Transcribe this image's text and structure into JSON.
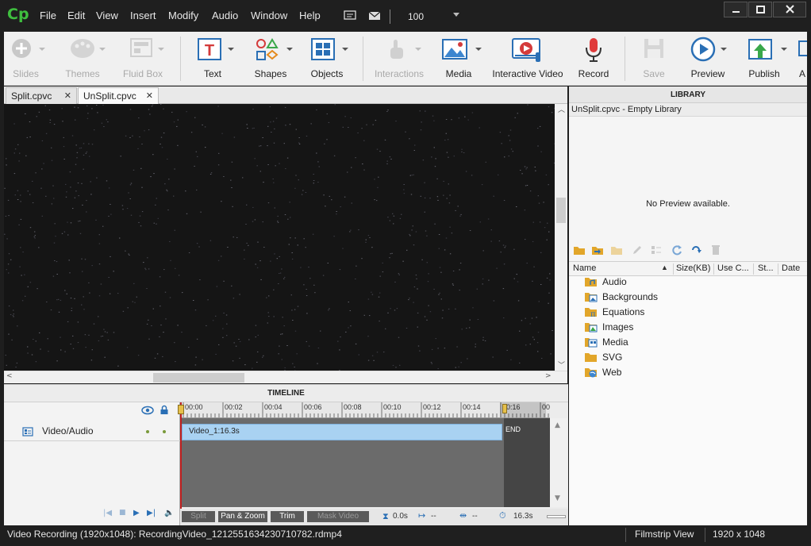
{
  "app": {
    "logo": "Cp",
    "menu": [
      "File",
      "Edit",
      "View",
      "Insert",
      "Modify",
      "Audio",
      "Window",
      "Help"
    ],
    "zoom": "100",
    "titlebar_icons": [
      "captions-icon",
      "mail-icon"
    ],
    "window_controls": [
      "minimize",
      "maximize",
      "close"
    ]
  },
  "toolbar": {
    "items": [
      {
        "label": "Slides",
        "icon": "add-slide-icon",
        "enabled": false
      },
      {
        "label": "Themes",
        "icon": "palette-icon",
        "enabled": false
      },
      {
        "label": "Fluid Box",
        "icon": "fluid-box-icon",
        "enabled": false
      },
      {
        "label": "Text",
        "icon": "text-icon",
        "enabled": true
      },
      {
        "label": "Shapes",
        "icon": "shapes-icon",
        "enabled": true
      },
      {
        "label": "Objects",
        "icon": "objects-icon",
        "enabled": true
      },
      {
        "label": "Interactions",
        "icon": "hand-pointer-icon",
        "enabled": false
      },
      {
        "label": "Media",
        "icon": "image-icon",
        "enabled": true
      },
      {
        "label": "Interactive Video",
        "icon": "interactive-video-icon",
        "enabled": true
      },
      {
        "label": "Record",
        "icon": "microphone-icon",
        "enabled": true
      },
      {
        "label": "Save",
        "icon": "save-icon",
        "enabled": false
      },
      {
        "label": "Preview",
        "icon": "play-circle-icon",
        "enabled": true
      },
      {
        "label": "Publish",
        "icon": "publish-icon",
        "enabled": true
      },
      {
        "label": "A",
        "icon": "",
        "enabled": true
      }
    ]
  },
  "tabs": [
    {
      "label": "Split.cpvc",
      "active": false
    },
    {
      "label": "UnSplit.cpvc",
      "active": true
    }
  ],
  "timeline": {
    "header": "TIMELINE",
    "track_label": "Video/Audio",
    "ruler": [
      "00:00",
      "00:02",
      "00:04",
      "00:06",
      "00:08",
      "00:10",
      "00:12",
      "00:14",
      "00:16",
      "00:"
    ],
    "clip_label": "Video_1:16.3s",
    "end_label": "END",
    "buttons": [
      {
        "label": "Split",
        "enabled": false
      },
      {
        "label": "Pan & Zoom",
        "enabled": true
      },
      {
        "label": "Trim",
        "enabled": true
      },
      {
        "label": "Mask Video",
        "enabled": false
      }
    ],
    "current_time": "0.0s",
    "in_point": "--",
    "out_point": "--",
    "duration": "16.3s"
  },
  "library": {
    "header": "LIBRARY",
    "subtitle": "UnSplit.cpvc - Empty Library",
    "preview_text": "No Preview available.",
    "columns": [
      "Name",
      "Size(KB)",
      "Use C...",
      "St...",
      "Date"
    ],
    "folders": [
      {
        "label": "Audio",
        "icon": "audio-folder-icon"
      },
      {
        "label": "Backgrounds",
        "icon": "backgrounds-folder-icon"
      },
      {
        "label": "Equations",
        "icon": "equations-folder-icon"
      },
      {
        "label": "Images",
        "icon": "images-folder-icon"
      },
      {
        "label": "Media",
        "icon": "media-folder-icon"
      },
      {
        "label": "SVG",
        "icon": "svg-folder-icon"
      },
      {
        "label": "Web",
        "icon": "web-folder-icon"
      }
    ]
  },
  "status": {
    "text": "Video Recording (1920x1048): RecordingVideo_1212551634230710782.rdmp4",
    "view": "Filmstrip View",
    "resolution": "1920 x 1048"
  }
}
